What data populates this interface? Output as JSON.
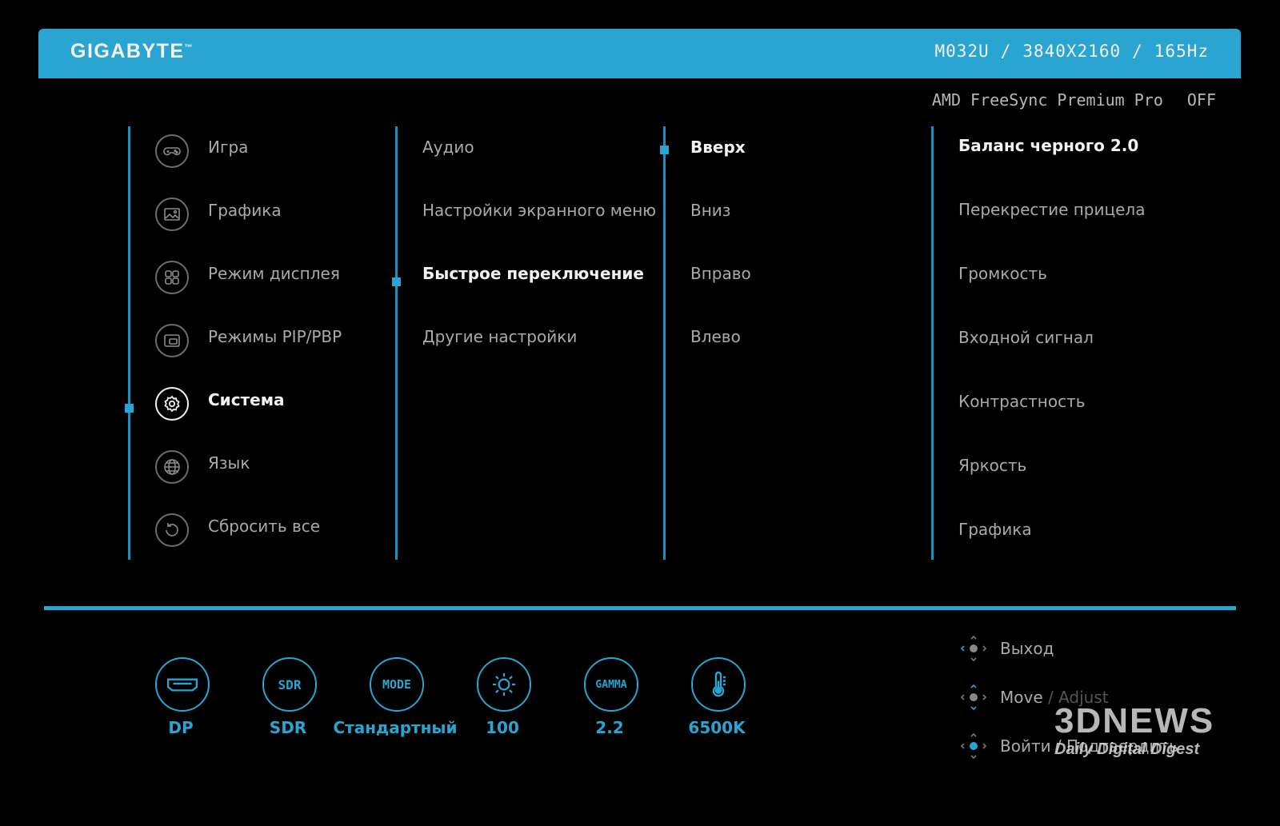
{
  "header": {
    "logo": "GIGABYTE",
    "model": "M032U",
    "resolution": "3840X2160",
    "refresh": "165Hz",
    "accent_color": "#2aa4d0"
  },
  "freesync": {
    "label": "AMD FreeSync Premium Pro",
    "state": "OFF"
  },
  "main_menu": [
    {
      "label": "Игра",
      "icon": "gamepad-icon"
    },
    {
      "label": "Графика",
      "icon": "picture-icon"
    },
    {
      "label": "Режим дисплея",
      "icon": "grid-icon"
    },
    {
      "label": "Режимы PIP/PBP",
      "icon": "pip-icon"
    },
    {
      "label": "Система",
      "icon": "gear-icon",
      "selected": true
    },
    {
      "label": "Язык",
      "icon": "globe-icon"
    },
    {
      "label": "Сбросить все",
      "icon": "reset-icon"
    }
  ],
  "system_menu": [
    {
      "label": "Аудио"
    },
    {
      "label": "Настройки экранного меню"
    },
    {
      "label": "Быстрое переключение",
      "selected": true
    },
    {
      "label": "Другие настройки"
    }
  ],
  "direction_menu": [
    {
      "label": "Вверх",
      "selected": true
    },
    {
      "label": "Вниз"
    },
    {
      "label": "Вправо"
    },
    {
      "label": "Влево"
    }
  ],
  "option_menu": [
    {
      "label": "Баланс черного 2.0",
      "selected": true
    },
    {
      "label": "Перекрестие прицела"
    },
    {
      "label": "Громкость"
    },
    {
      "label": "Входной сигнал"
    },
    {
      "label": "Контрастность"
    },
    {
      "label": "Яркость"
    },
    {
      "label": "Графика"
    }
  ],
  "status_bar": [
    {
      "icon": "displayport-icon",
      "badge": "",
      "value": "DP"
    },
    {
      "icon": "sdr-icon",
      "badge": "SDR",
      "value": "SDR"
    },
    {
      "icon": "mode-icon",
      "badge": "MODE",
      "value": "Стандартный"
    },
    {
      "icon": "brightness-icon",
      "badge": "",
      "value": "100"
    },
    {
      "icon": "gamma-icon",
      "badge": "GAMMA",
      "value": "2.2"
    },
    {
      "icon": "thermometer-icon",
      "badge": "",
      "value": "6500K"
    }
  ],
  "navigation": [
    {
      "label": "Выход",
      "extra": ""
    },
    {
      "label": "Move",
      "extra": "/ Adjust"
    },
    {
      "label": "Войти / Подтвердить",
      "extra": ""
    }
  ],
  "watermark": {
    "title": "3DNEWS",
    "subtitle": "Daily Digital Digest"
  }
}
